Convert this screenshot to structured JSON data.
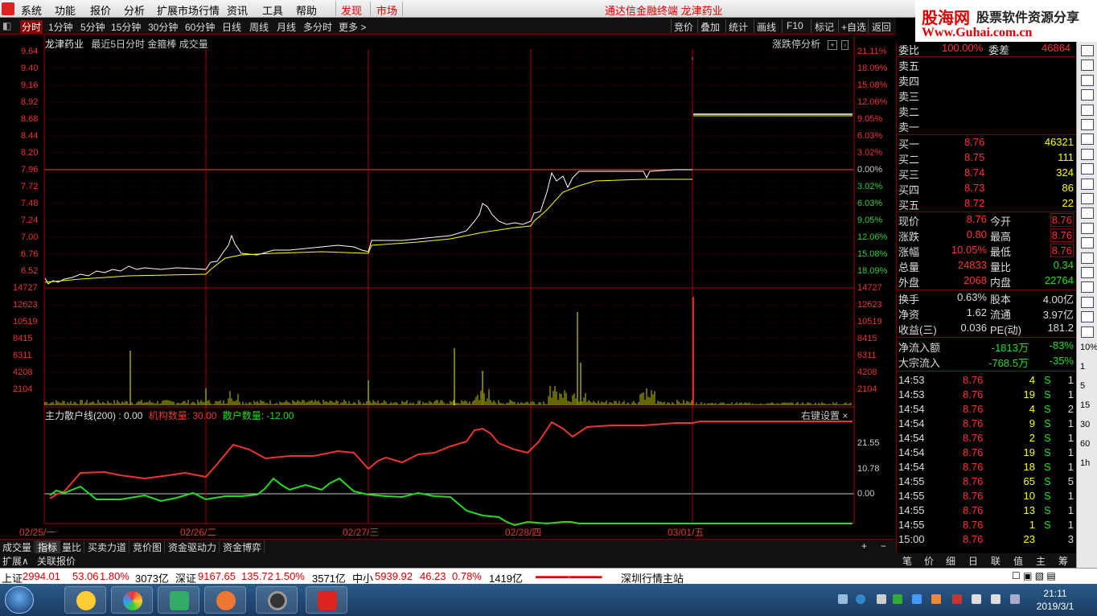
{
  "menubar": {
    "items": [
      "系统",
      "功能",
      "报价",
      "分析",
      "扩展市场行情",
      "资讯",
      "工具",
      "帮助"
    ],
    "discover": "发现",
    "market": "市场",
    "title": "通达信金融终端 龙津药业"
  },
  "ad": {
    "site": "股海网",
    "slogan": "股票软件资源分享",
    "url": "Www.Guhai.com.cn"
  },
  "tabs": {
    "periods": [
      "分时",
      "1分钟",
      "5分钟",
      "15分钟",
      "30分钟",
      "60分钟",
      "日线",
      "周线",
      "月线",
      "多分时",
      "更多 >"
    ],
    "right": [
      "竞价",
      "叠加",
      "统计",
      "画线",
      "F10",
      "标记",
      "+自选",
      "返回"
    ]
  },
  "chart": {
    "stock_name": "龙津药业",
    "subtitle": "最近5日分时 金箍棒 成交量",
    "zdt": "涨跌停分析",
    "price_ticks": [
      "9.64",
      "9.40",
      "9.16",
      "8.92",
      "8.68",
      "8.44",
      "8.20",
      "7.96",
      "7.72",
      "7.48",
      "7.24",
      "7.00",
      "6.76",
      "6.52"
    ],
    "pct_ticks": [
      "21.11%",
      "18.09%",
      "15.08%",
      "12.06%",
      "9.05%",
      "6.03%",
      "3.02%",
      "0.00%",
      "3.02%",
      "6.03%",
      "9.05%",
      "12.06%",
      "15.08%",
      "18.09%"
    ],
    "vol_ticks": [
      "14727",
      "12623",
      "10519",
      "8415",
      "6311",
      "4208",
      "2104"
    ],
    "indicator_label": "主力散户线(200) : 0.00",
    "inst_label": "机构数量: 30.00",
    "retail_label": "散户数量: -12.00",
    "ind_ticks": [
      "21.55",
      "10.78",
      "0.00"
    ],
    "right_settings": "右键设置 ×",
    "dates": [
      "02/25/一",
      "02/26/二",
      "02/27/三",
      "02/28/四",
      "03/01/五"
    ]
  },
  "bottom_tabs": [
    "成交量",
    "指标",
    "量比",
    "买卖力道",
    "竞价图",
    "资金驱动力",
    "资金博弈"
  ],
  "bottom_tabs2": [
    "扩展∧",
    "关联报价"
  ],
  "quote": {
    "wb_label": "委比",
    "wb_val": "100.00%",
    "wc_label": "委差",
    "wc_val": "46864",
    "sell": [
      "卖五",
      "卖四",
      "卖三",
      "卖二",
      "卖一"
    ],
    "buy": [
      {
        "label": "买一",
        "price": "8.76",
        "vol": "46321"
      },
      {
        "label": "买二",
        "price": "8.75",
        "vol": "111"
      },
      {
        "label": "买三",
        "price": "8.74",
        "vol": "324"
      },
      {
        "label": "买四",
        "price": "8.73",
        "vol": "86"
      },
      {
        "label": "买五",
        "price": "8.72",
        "vol": "22"
      }
    ],
    "stats": [
      {
        "l1": "现价",
        "v1": "8.76",
        "l2": "今开",
        "v2": "8.76"
      },
      {
        "l1": "涨跌",
        "v1": "0.80",
        "l2": "最高",
        "v2": "8.76"
      },
      {
        "l1": "涨幅",
        "v1": "10.05%",
        "l2": "最低",
        "v2": "8.76"
      },
      {
        "l1": "总量",
        "v1": "24833",
        "l2": "量比",
        "v2": "0.34"
      },
      {
        "l1": "外盘",
        "v1": "2068",
        "l2": "内盘",
        "v2": "22764"
      }
    ],
    "stats2": [
      {
        "l1": "换手",
        "v1": "0.63%",
        "l2": "股本",
        "v2": "4.00亿"
      },
      {
        "l1": "净资",
        "v1": "1.62",
        "l2": "流通",
        "v2": "3.97亿"
      },
      {
        "l1": "收益(三)",
        "v1": "0.036",
        "l2": "PE(动)",
        "v2": "181.2"
      }
    ],
    "flow": [
      {
        "label": "净流入额",
        "val": "-1813万",
        "pct": "-83%"
      },
      {
        "label": "大宗流入",
        "val": "-768.5万",
        "pct": "-35%"
      }
    ],
    "ticks": [
      {
        "t": "14:53",
        "p": "8.76",
        "v": "4",
        "s": "S",
        "n": "1"
      },
      {
        "t": "14:53",
        "p": "8.76",
        "v": "19",
        "s": "S",
        "n": "1"
      },
      {
        "t": "14:54",
        "p": "8.76",
        "v": "4",
        "s": "S",
        "n": "2"
      },
      {
        "t": "14:54",
        "p": "8.76",
        "v": "9",
        "s": "S",
        "n": "1"
      },
      {
        "t": "14:54",
        "p": "8.76",
        "v": "2",
        "s": "S",
        "n": "1"
      },
      {
        "t": "14:54",
        "p": "8.76",
        "v": "19",
        "s": "S",
        "n": "1"
      },
      {
        "t": "14:54",
        "p": "8.76",
        "v": "18",
        "s": "S",
        "n": "1"
      },
      {
        "t": "14:55",
        "p": "8.76",
        "v": "65",
        "s": "S",
        "n": "5"
      },
      {
        "t": "14:55",
        "p": "8.76",
        "v": "10",
        "s": "S",
        "n": "1"
      },
      {
        "t": "14:55",
        "p": "8.76",
        "v": "13",
        "s": "S",
        "n": "1"
      },
      {
        "t": "14:55",
        "p": "8.76",
        "v": "1",
        "s": "S",
        "n": "1"
      },
      {
        "t": "15:00",
        "p": "8.76",
        "v": "23",
        "s": "",
        "n": "3"
      }
    ],
    "tabs": [
      "笔",
      "价",
      "细",
      "日",
      "联",
      "值",
      "主",
      "筹"
    ]
  },
  "side_numbers": [
    "10%",
    "1",
    "5",
    "15",
    "30",
    "60",
    "1h"
  ],
  "status": {
    "sh_label": "上证",
    "sh_val": "2994.01",
    "sh_chg": "53.06",
    "sh_pct": "1.80%",
    "sh_amt": "3073亿",
    "sz_label": "深证",
    "sz_val": "9167.65",
    "sz_chg": "135.72",
    "sz_pct": "1.50%",
    "sz_amt": "3571亿",
    "zx_label": "中小",
    "zx_val": "5939.92",
    "zx_chg": "46.23",
    "zx_pct": "0.78%",
    "zx_amt": "1419亿",
    "server": "深圳行情主站"
  },
  "clock": {
    "time": "21:11",
    "date": "2019/3/1"
  }
}
